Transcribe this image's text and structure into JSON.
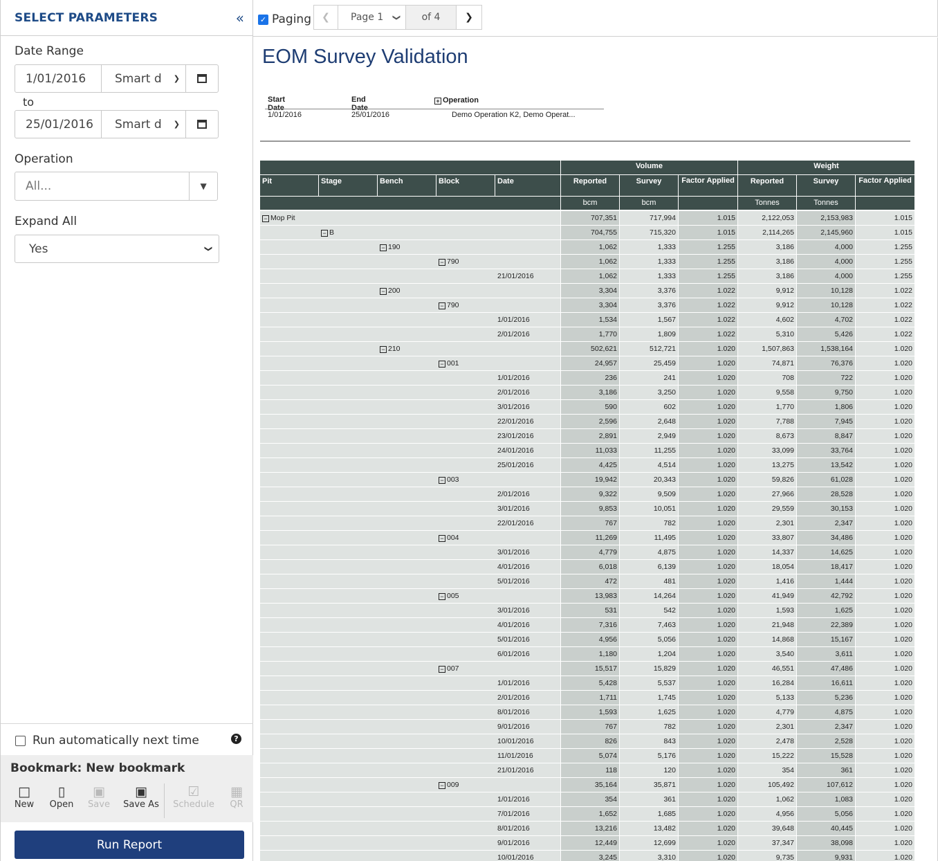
{
  "sidebar": {
    "title": "SELECT PARAMETERS",
    "collapse_icon": "double-chevron-left-icon",
    "date_range_label": "Date Range",
    "start_date": "1/01/2016",
    "start_smart": "Smart d",
    "to_label": "to",
    "end_date": "25/01/2016",
    "end_smart": "Smart d",
    "operation_label": "Operation",
    "operation_value": "All...",
    "expand_label": "Expand All",
    "expand_value": "Yes",
    "run_auto_label": "Run automatically next time",
    "run_auto_checked": false,
    "bookmark_title": "Bookmark: New bookmark",
    "actions": [
      {
        "label": "New",
        "icon": "file-icon",
        "enabled": true
      },
      {
        "label": "Open",
        "icon": "folder-open-icon",
        "enabled": true
      },
      {
        "label": "Save",
        "icon": "save-icon",
        "enabled": false
      },
      {
        "label": "Save As",
        "icon": "save-as-icon",
        "enabled": true
      },
      {
        "label": "Schedule",
        "icon": "calendar-check-icon",
        "enabled": false
      },
      {
        "label": "QR",
        "icon": "qr-code-icon",
        "enabled": false
      }
    ],
    "run_button": "Run Report"
  },
  "topbar": {
    "paging_label": "Paging",
    "paging_checked": true,
    "page_select": "Page 1",
    "of_pages": "of 4"
  },
  "report": {
    "title": "EOM Survey Validation",
    "params": {
      "start_date_header": "Start Date",
      "end_date_header": "End Date",
      "operation_header": "Operation",
      "start_date": "1/01/2016",
      "end_date": "25/01/2016",
      "operation": "Demo Operation K2, Demo Operat..."
    },
    "group_headers": {
      "volume": "Volume",
      "weight": "Weight"
    },
    "columns": [
      "Pit",
      "Stage",
      "Bench",
      "Block",
      "Date",
      "Reported",
      "Survey",
      "Factor Applied",
      "Reported",
      "Survey",
      "Factor Applied"
    ],
    "units": [
      "bcm",
      "bcm",
      "Tonnes",
      "Tonnes"
    ],
    "rows": [
      {
        "level": 0,
        "label": "Mop Pit",
        "vr": "707,351",
        "vs": "717,994",
        "vf": "1.015",
        "wr": "2,122,053",
        "ws": "2,153,983",
        "wf": "1.015"
      },
      {
        "level": 1,
        "label": "B",
        "vr": "704,755",
        "vs": "715,320",
        "vf": "1.015",
        "wr": "2,114,265",
        "ws": "2,145,960",
        "wf": "1.015"
      },
      {
        "level": 2,
        "label": "190",
        "vr": "1,062",
        "vs": "1,333",
        "vf": "1.255",
        "wr": "3,186",
        "ws": "4,000",
        "wf": "1.255"
      },
      {
        "level": 3,
        "label": "790",
        "vr": "1,062",
        "vs": "1,333",
        "vf": "1.255",
        "wr": "3,186",
        "ws": "4,000",
        "wf": "1.255"
      },
      {
        "level": 4,
        "label": "21/01/2016",
        "vr": "1,062",
        "vs": "1,333",
        "vf": "1.255",
        "wr": "3,186",
        "ws": "4,000",
        "wf": "1.255"
      },
      {
        "level": 2,
        "label": "200",
        "vr": "3,304",
        "vs": "3,376",
        "vf": "1.022",
        "wr": "9,912",
        "ws": "10,128",
        "wf": "1.022"
      },
      {
        "level": 3,
        "label": "790",
        "vr": "3,304",
        "vs": "3,376",
        "vf": "1.022",
        "wr": "9,912",
        "ws": "10,128",
        "wf": "1.022"
      },
      {
        "level": 4,
        "label": "1/01/2016",
        "vr": "1,534",
        "vs": "1,567",
        "vf": "1.022",
        "wr": "4,602",
        "ws": "4,702",
        "wf": "1.022"
      },
      {
        "level": 4,
        "label": "2/01/2016",
        "vr": "1,770",
        "vs": "1,809",
        "vf": "1.022",
        "wr": "5,310",
        "ws": "5,426",
        "wf": "1.022"
      },
      {
        "level": 2,
        "label": "210",
        "vr": "502,621",
        "vs": "512,721",
        "vf": "1.020",
        "wr": "1,507,863",
        "ws": "1,538,164",
        "wf": "1.020"
      },
      {
        "level": 3,
        "label": "001",
        "vr": "24,957",
        "vs": "25,459",
        "vf": "1.020",
        "wr": "74,871",
        "ws": "76,376",
        "wf": "1.020"
      },
      {
        "level": 4,
        "label": "1/01/2016",
        "vr": "236",
        "vs": "241",
        "vf": "1.020",
        "wr": "708",
        "ws": "722",
        "wf": "1.020"
      },
      {
        "level": 4,
        "label": "2/01/2016",
        "vr": "3,186",
        "vs": "3,250",
        "vf": "1.020",
        "wr": "9,558",
        "ws": "9,750",
        "wf": "1.020"
      },
      {
        "level": 4,
        "label": "3/01/2016",
        "vr": "590",
        "vs": "602",
        "vf": "1.020",
        "wr": "1,770",
        "ws": "1,806",
        "wf": "1.020"
      },
      {
        "level": 4,
        "label": "22/01/2016",
        "vr": "2,596",
        "vs": "2,648",
        "vf": "1.020",
        "wr": "7,788",
        "ws": "7,945",
        "wf": "1.020"
      },
      {
        "level": 4,
        "label": "23/01/2016",
        "vr": "2,891",
        "vs": "2,949",
        "vf": "1.020",
        "wr": "8,673",
        "ws": "8,847",
        "wf": "1.020"
      },
      {
        "level": 4,
        "label": "24/01/2016",
        "vr": "11,033",
        "vs": "11,255",
        "vf": "1.020",
        "wr": "33,099",
        "ws": "33,764",
        "wf": "1.020"
      },
      {
        "level": 4,
        "label": "25/01/2016",
        "vr": "4,425",
        "vs": "4,514",
        "vf": "1.020",
        "wr": "13,275",
        "ws": "13,542",
        "wf": "1.020"
      },
      {
        "level": 3,
        "label": "003",
        "vr": "19,942",
        "vs": "20,343",
        "vf": "1.020",
        "wr": "59,826",
        "ws": "61,028",
        "wf": "1.020"
      },
      {
        "level": 4,
        "label": "2/01/2016",
        "vr": "9,322",
        "vs": "9,509",
        "vf": "1.020",
        "wr": "27,966",
        "ws": "28,528",
        "wf": "1.020"
      },
      {
        "level": 4,
        "label": "3/01/2016",
        "vr": "9,853",
        "vs": "10,051",
        "vf": "1.020",
        "wr": "29,559",
        "ws": "30,153",
        "wf": "1.020"
      },
      {
        "level": 4,
        "label": "22/01/2016",
        "vr": "767",
        "vs": "782",
        "vf": "1.020",
        "wr": "2,301",
        "ws": "2,347",
        "wf": "1.020"
      },
      {
        "level": 3,
        "label": "004",
        "vr": "11,269",
        "vs": "11,495",
        "vf": "1.020",
        "wr": "33,807",
        "ws": "34,486",
        "wf": "1.020"
      },
      {
        "level": 4,
        "label": "3/01/2016",
        "vr": "4,779",
        "vs": "4,875",
        "vf": "1.020",
        "wr": "14,337",
        "ws": "14,625",
        "wf": "1.020"
      },
      {
        "level": 4,
        "label": "4/01/2016",
        "vr": "6,018",
        "vs": "6,139",
        "vf": "1.020",
        "wr": "18,054",
        "ws": "18,417",
        "wf": "1.020"
      },
      {
        "level": 4,
        "label": "5/01/2016",
        "vr": "472",
        "vs": "481",
        "vf": "1.020",
        "wr": "1,416",
        "ws": "1,444",
        "wf": "1.020"
      },
      {
        "level": 3,
        "label": "005",
        "vr": "13,983",
        "vs": "14,264",
        "vf": "1.020",
        "wr": "41,949",
        "ws": "42,792",
        "wf": "1.020"
      },
      {
        "level": 4,
        "label": "3/01/2016",
        "vr": "531",
        "vs": "542",
        "vf": "1.020",
        "wr": "1,593",
        "ws": "1,625",
        "wf": "1.020"
      },
      {
        "level": 4,
        "label": "4/01/2016",
        "vr": "7,316",
        "vs": "7,463",
        "vf": "1.020",
        "wr": "21,948",
        "ws": "22,389",
        "wf": "1.020"
      },
      {
        "level": 4,
        "label": "5/01/2016",
        "vr": "4,956",
        "vs": "5,056",
        "vf": "1.020",
        "wr": "14,868",
        "ws": "15,167",
        "wf": "1.020"
      },
      {
        "level": 4,
        "label": "6/01/2016",
        "vr": "1,180",
        "vs": "1,204",
        "vf": "1.020",
        "wr": "3,540",
        "ws": "3,611",
        "wf": "1.020"
      },
      {
        "level": 3,
        "label": "007",
        "vr": "15,517",
        "vs": "15,829",
        "vf": "1.020",
        "wr": "46,551",
        "ws": "47,486",
        "wf": "1.020"
      },
      {
        "level": 4,
        "label": "1/01/2016",
        "vr": "5,428",
        "vs": "5,537",
        "vf": "1.020",
        "wr": "16,284",
        "ws": "16,611",
        "wf": "1.020"
      },
      {
        "level": 4,
        "label": "2/01/2016",
        "vr": "1,711",
        "vs": "1,745",
        "vf": "1.020",
        "wr": "5,133",
        "ws": "5,236",
        "wf": "1.020"
      },
      {
        "level": 4,
        "label": "8/01/2016",
        "vr": "1,593",
        "vs": "1,625",
        "vf": "1.020",
        "wr": "4,779",
        "ws": "4,875",
        "wf": "1.020"
      },
      {
        "level": 4,
        "label": "9/01/2016",
        "vr": "767",
        "vs": "782",
        "vf": "1.020",
        "wr": "2,301",
        "ws": "2,347",
        "wf": "1.020"
      },
      {
        "level": 4,
        "label": "10/01/2016",
        "vr": "826",
        "vs": "843",
        "vf": "1.020",
        "wr": "2,478",
        "ws": "2,528",
        "wf": "1.020"
      },
      {
        "level": 4,
        "label": "11/01/2016",
        "vr": "5,074",
        "vs": "5,176",
        "vf": "1.020",
        "wr": "15,222",
        "ws": "15,528",
        "wf": "1.020"
      },
      {
        "level": 4,
        "label": "21/01/2016",
        "vr": "118",
        "vs": "120",
        "vf": "1.020",
        "wr": "354",
        "ws": "361",
        "wf": "1.020"
      },
      {
        "level": 3,
        "label": "009",
        "vr": "35,164",
        "vs": "35,871",
        "vf": "1.020",
        "wr": "105,492",
        "ws": "107,612",
        "wf": "1.020"
      },
      {
        "level": 4,
        "label": "1/01/2016",
        "vr": "354",
        "vs": "361",
        "vf": "1.020",
        "wr": "1,062",
        "ws": "1,083",
        "wf": "1.020"
      },
      {
        "level": 4,
        "label": "7/01/2016",
        "vr": "1,652",
        "vs": "1,685",
        "vf": "1.020",
        "wr": "4,956",
        "ws": "5,056",
        "wf": "1.020"
      },
      {
        "level": 4,
        "label": "8/01/2016",
        "vr": "13,216",
        "vs": "13,482",
        "vf": "1.020",
        "wr": "39,648",
        "ws": "40,445",
        "wf": "1.020"
      },
      {
        "level": 4,
        "label": "9/01/2016",
        "vr": "12,449",
        "vs": "12,699",
        "vf": "1.020",
        "wr": "37,347",
        "ws": "38,098",
        "wf": "1.020"
      },
      {
        "level": 4,
        "label": "10/01/2016",
        "vr": "3,245",
        "vs": "3,310",
        "vf": "1.020",
        "wr": "9,735",
        "ws": "9,931",
        "wf": "1.020"
      }
    ]
  }
}
